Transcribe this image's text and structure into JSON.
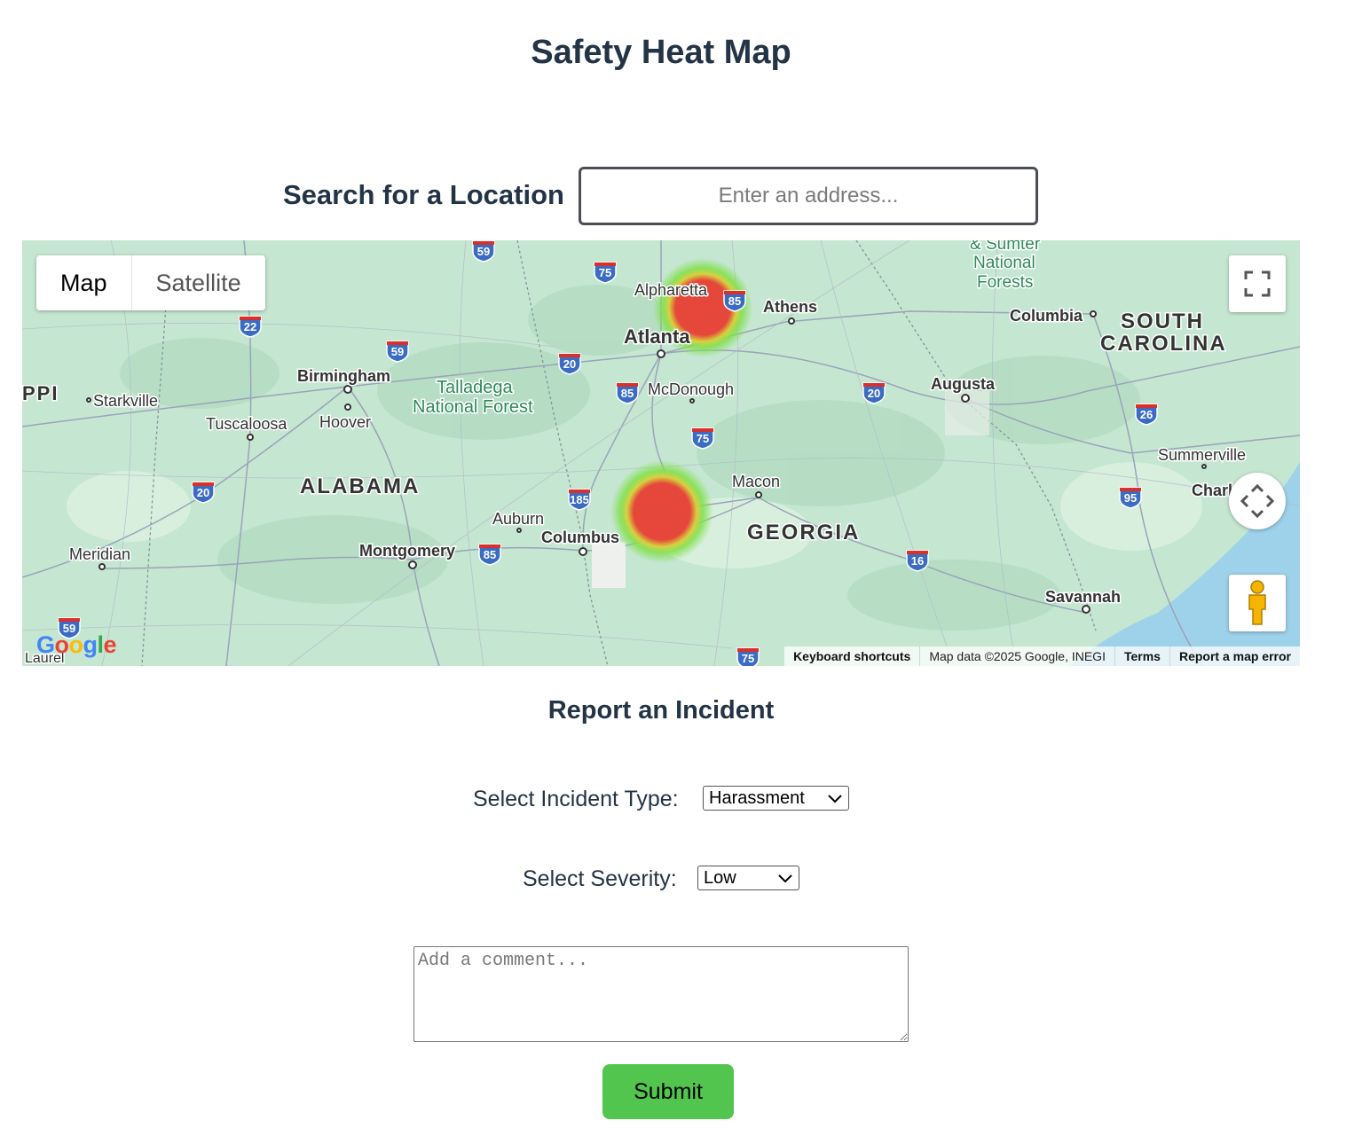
{
  "header": {
    "title": "Safety Heat Map"
  },
  "search": {
    "label": "Search for a Location",
    "placeholder": "Enter an address..."
  },
  "map": {
    "type_buttons": {
      "map": "Map",
      "satellite": "Satellite"
    },
    "attribution": {
      "keyboard": "Keyboard shortcuts",
      "data": "Map data ©2025 Google, INEGI",
      "terms": "Terms",
      "report": "Report a map error"
    },
    "logo": "Google",
    "cities": {
      "alpharetta": "Alpharetta",
      "athens": "Athens",
      "atlanta": "Atlanta",
      "columbia": "Columbia",
      "birmingham": "Birmingham",
      "mcdonough": "McDonough",
      "augusta": "Augusta",
      "starkville": "Starkville",
      "hoover": "Hoover",
      "tuscaloosa": "Tuscaloosa",
      "summerville": "Summerville",
      "macon": "Macon",
      "auburn": "Auburn",
      "charleston": "Charl",
      "columbus": "Columbus",
      "montgomery": "Montgomery",
      "meridian": "Meridian",
      "savannah": "Savannah",
      "laurel": "Laurel"
    },
    "regions": {
      "sumter1": "& Sumter",
      "sumter2": "National",
      "sumter3": "Forests",
      "south": "SOUTH",
      "carolina": "CAROLINA",
      "talladega1": "Talladega",
      "talladega2": "National Forest",
      "alabama": "ALABAMA",
      "georgia": "GEORGIA",
      "ppi": "PPI"
    },
    "highways": [
      "59",
      "75",
      "85",
      "22",
      "59",
      "20",
      "85",
      "20",
      "26",
      "75",
      "20",
      "185",
      "95",
      "85",
      "16",
      "59",
      "75"
    ],
    "heat_colors": {
      "core": "#e5473a",
      "glow": "#7fe04a"
    }
  },
  "report": {
    "title": "Report an Incident",
    "incident_label": "Select Incident Type:",
    "incident_value": "Harassment",
    "severity_label": "Select Severity:",
    "severity_value": "Low",
    "comment_placeholder": "Add a comment...",
    "submit_label": "Submit"
  },
  "colors": {
    "submit": "#52c54f",
    "title": "#233446"
  }
}
